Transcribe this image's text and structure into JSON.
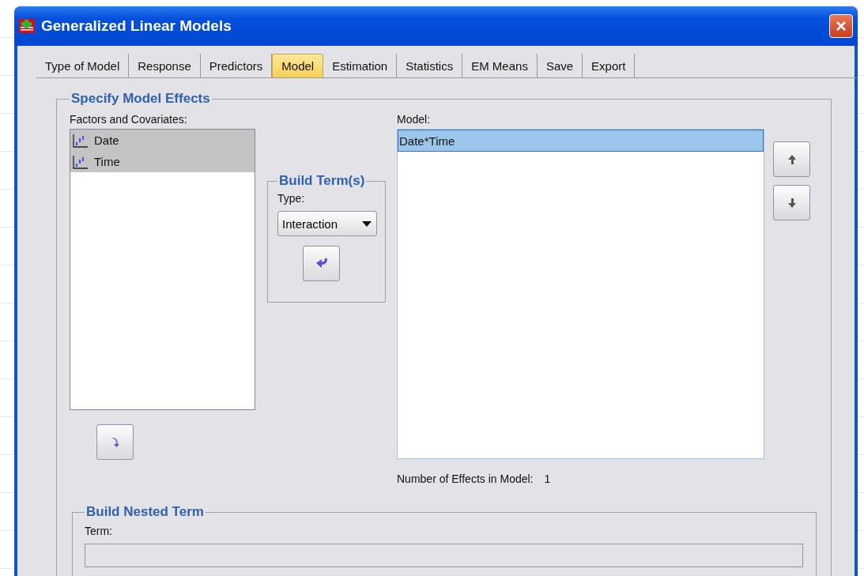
{
  "window": {
    "title": "Generalized Linear Models"
  },
  "tabs": [
    {
      "label": "Type of Model",
      "selected": false
    },
    {
      "label": "Response",
      "selected": false
    },
    {
      "label": "Predictors",
      "selected": false
    },
    {
      "label": "Model",
      "selected": true
    },
    {
      "label": "Estimation",
      "selected": false
    },
    {
      "label": "Statistics",
      "selected": false
    },
    {
      "label": "EM Means",
      "selected": false
    },
    {
      "label": "Save",
      "selected": false
    },
    {
      "label": "Export",
      "selected": false
    }
  ],
  "specify_model_effects": {
    "title": "Specify Model Effects",
    "factors_and_covariates": {
      "label": "Factors and Covariates:",
      "items": [
        {
          "name": "Date",
          "selected": true
        },
        {
          "name": "Time",
          "selected": true
        }
      ]
    },
    "build_terms": {
      "title": "Build Term(s)",
      "type_label": "Type:",
      "type_value": "Interaction"
    },
    "model": {
      "label": "Model:",
      "items": [
        {
          "name": "Date*Time",
          "selected": true
        }
      ]
    },
    "number_of_effects": {
      "label": "Number of Effects in Model:",
      "value": "1"
    }
  },
  "build_nested_term": {
    "title": "Build Nested Term",
    "term_label": "Term:"
  }
}
